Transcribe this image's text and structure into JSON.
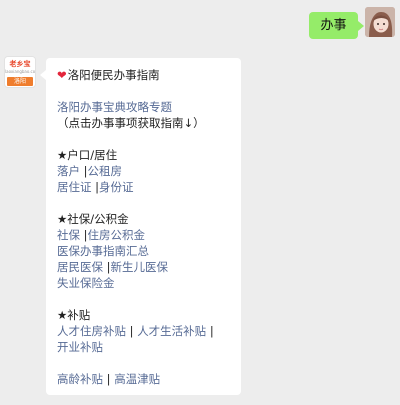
{
  "outgoing": {
    "text": "办事"
  },
  "bot": {
    "avatar": {
      "name": "老乡宝",
      "sub": "laoxiangbao.com",
      "city": "洛阳"
    }
  },
  "message": {
    "title": "洛阳便民办事指南",
    "intro_link": "洛阳办事宝典攻略专题",
    "intro_hint": "（点击办事事项获取指南↓）",
    "sections": [
      {
        "heading": "★户口/居住",
        "rows": [
          [
            "落户",
            "公租房"
          ],
          [
            "居住证",
            "身份证"
          ]
        ]
      },
      {
        "heading": "★社保/公积金",
        "rows": [
          [
            "社保",
            "住房公积金"
          ],
          [
            "医保办事指南汇总"
          ],
          [
            "居民医保",
            "新生儿医保"
          ],
          [
            "失业保险金"
          ]
        ]
      },
      {
        "heading": "★补贴",
        "rows": [
          [
            "人才住房补贴",
            "人才生活补贴"
          ],
          [
            "开业补贴"
          ]
        ]
      }
    ],
    "extra_row": [
      "高龄补贴",
      "高温津贴"
    ]
  },
  "colors": {
    "link": "#576b95",
    "own_bubble": "#95ec69",
    "background": "#ededed"
  }
}
